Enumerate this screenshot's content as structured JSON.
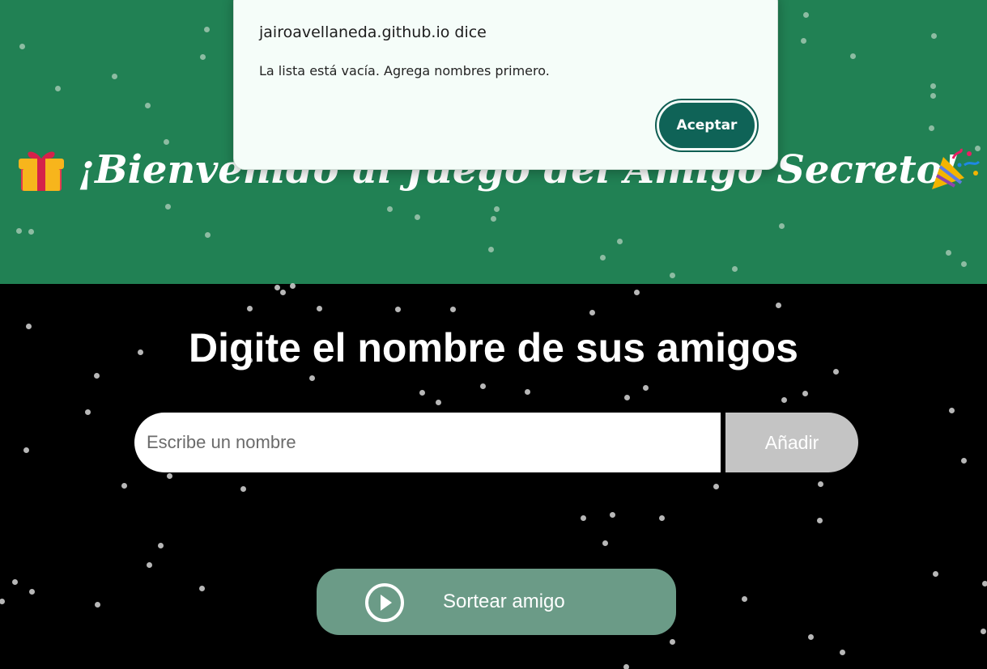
{
  "colors": {
    "header_bg": "#218154",
    "main_bg": "#000000",
    "add_button_bg": "#c4c4c4",
    "draw_button_bg": "#6b9b87",
    "dialog_button_bg": "#0f6357"
  },
  "header": {
    "title": "¡Bienvenido al Juego del Amigo Secreto!",
    "left_icon": "gift-icon",
    "right_icon": "party-popper-icon"
  },
  "main": {
    "subtitle": "Digite el nombre de sus amigos",
    "name_input": {
      "placeholder": "Escribe un nombre",
      "value": ""
    },
    "add_button_label": "Añadir",
    "draw_button_label": "Sortear amigo",
    "draw_button_icon": "play-circle-icon"
  },
  "dialog": {
    "title": "jairoavellaneda.github.io dice",
    "message": "La lista está vacía. Agrega nombres primero.",
    "ok_label": "Aceptar"
  }
}
